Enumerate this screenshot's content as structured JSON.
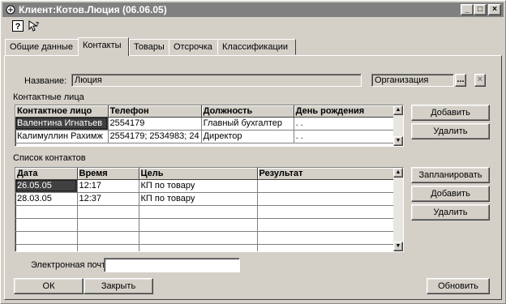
{
  "window": {
    "title": "Клиент:Котов.Люция (06.06.05)",
    "minimize_glyph": "_",
    "maximize_glyph": "□",
    "close_glyph": "×"
  },
  "toolbar": {
    "help_icon": "help-icon",
    "whats_this_icon": "whats-this-icon"
  },
  "tabs": [
    {
      "label": "Общие данные"
    },
    {
      "label": "Контакты"
    },
    {
      "label": "Товары"
    },
    {
      "label": "Отсрочка"
    },
    {
      "label": "Классификации"
    }
  ],
  "active_tab": "Контакты",
  "name_row": {
    "label": "Название:",
    "value": "Люция",
    "org_type": "Организация",
    "browse_label": "...",
    "clear_label": "×"
  },
  "contact_persons": {
    "title": "Контактные лица",
    "columns": [
      "Контактное лицо",
      "Телефон",
      "Должность",
      "День рождения"
    ],
    "rows": [
      [
        "Валентина Игнатьев",
        "2554179",
        "Главный бухгалтер",
        " .  ."
      ],
      [
        "Калимуллин Рахимж",
        "2554179; 2534983; 24",
        "Директор",
        " .  ."
      ]
    ],
    "add_label": "Добавить",
    "delete_label": "Удалить"
  },
  "contacts_list": {
    "title": "Список контактов",
    "columns": [
      "Дата",
      "Время",
      "Цель",
      "Результат"
    ],
    "rows": [
      [
        "26.05.05",
        "12:17",
        "КП по товару",
        ""
      ],
      [
        "28.03.05",
        "12:37",
        "КП по товару",
        ""
      ],
      [
        "",
        "",
        "",
        ""
      ],
      [
        "",
        "",
        "",
        ""
      ],
      [
        "",
        "",
        "",
        ""
      ],
      [
        "",
        "",
        "",
        ""
      ]
    ],
    "plan_label": "Запланировать",
    "add_label": "Добавить",
    "delete_label": "Удалить"
  },
  "email": {
    "label": "Электронная почта:",
    "value": ""
  },
  "footer": {
    "ok_label": "ОК",
    "close_label": "Закрыть",
    "refresh_label": "Обновить"
  },
  "colors": {
    "face": "#d4d0c8",
    "title_inactive": "#808080",
    "selection": "#404040"
  }
}
